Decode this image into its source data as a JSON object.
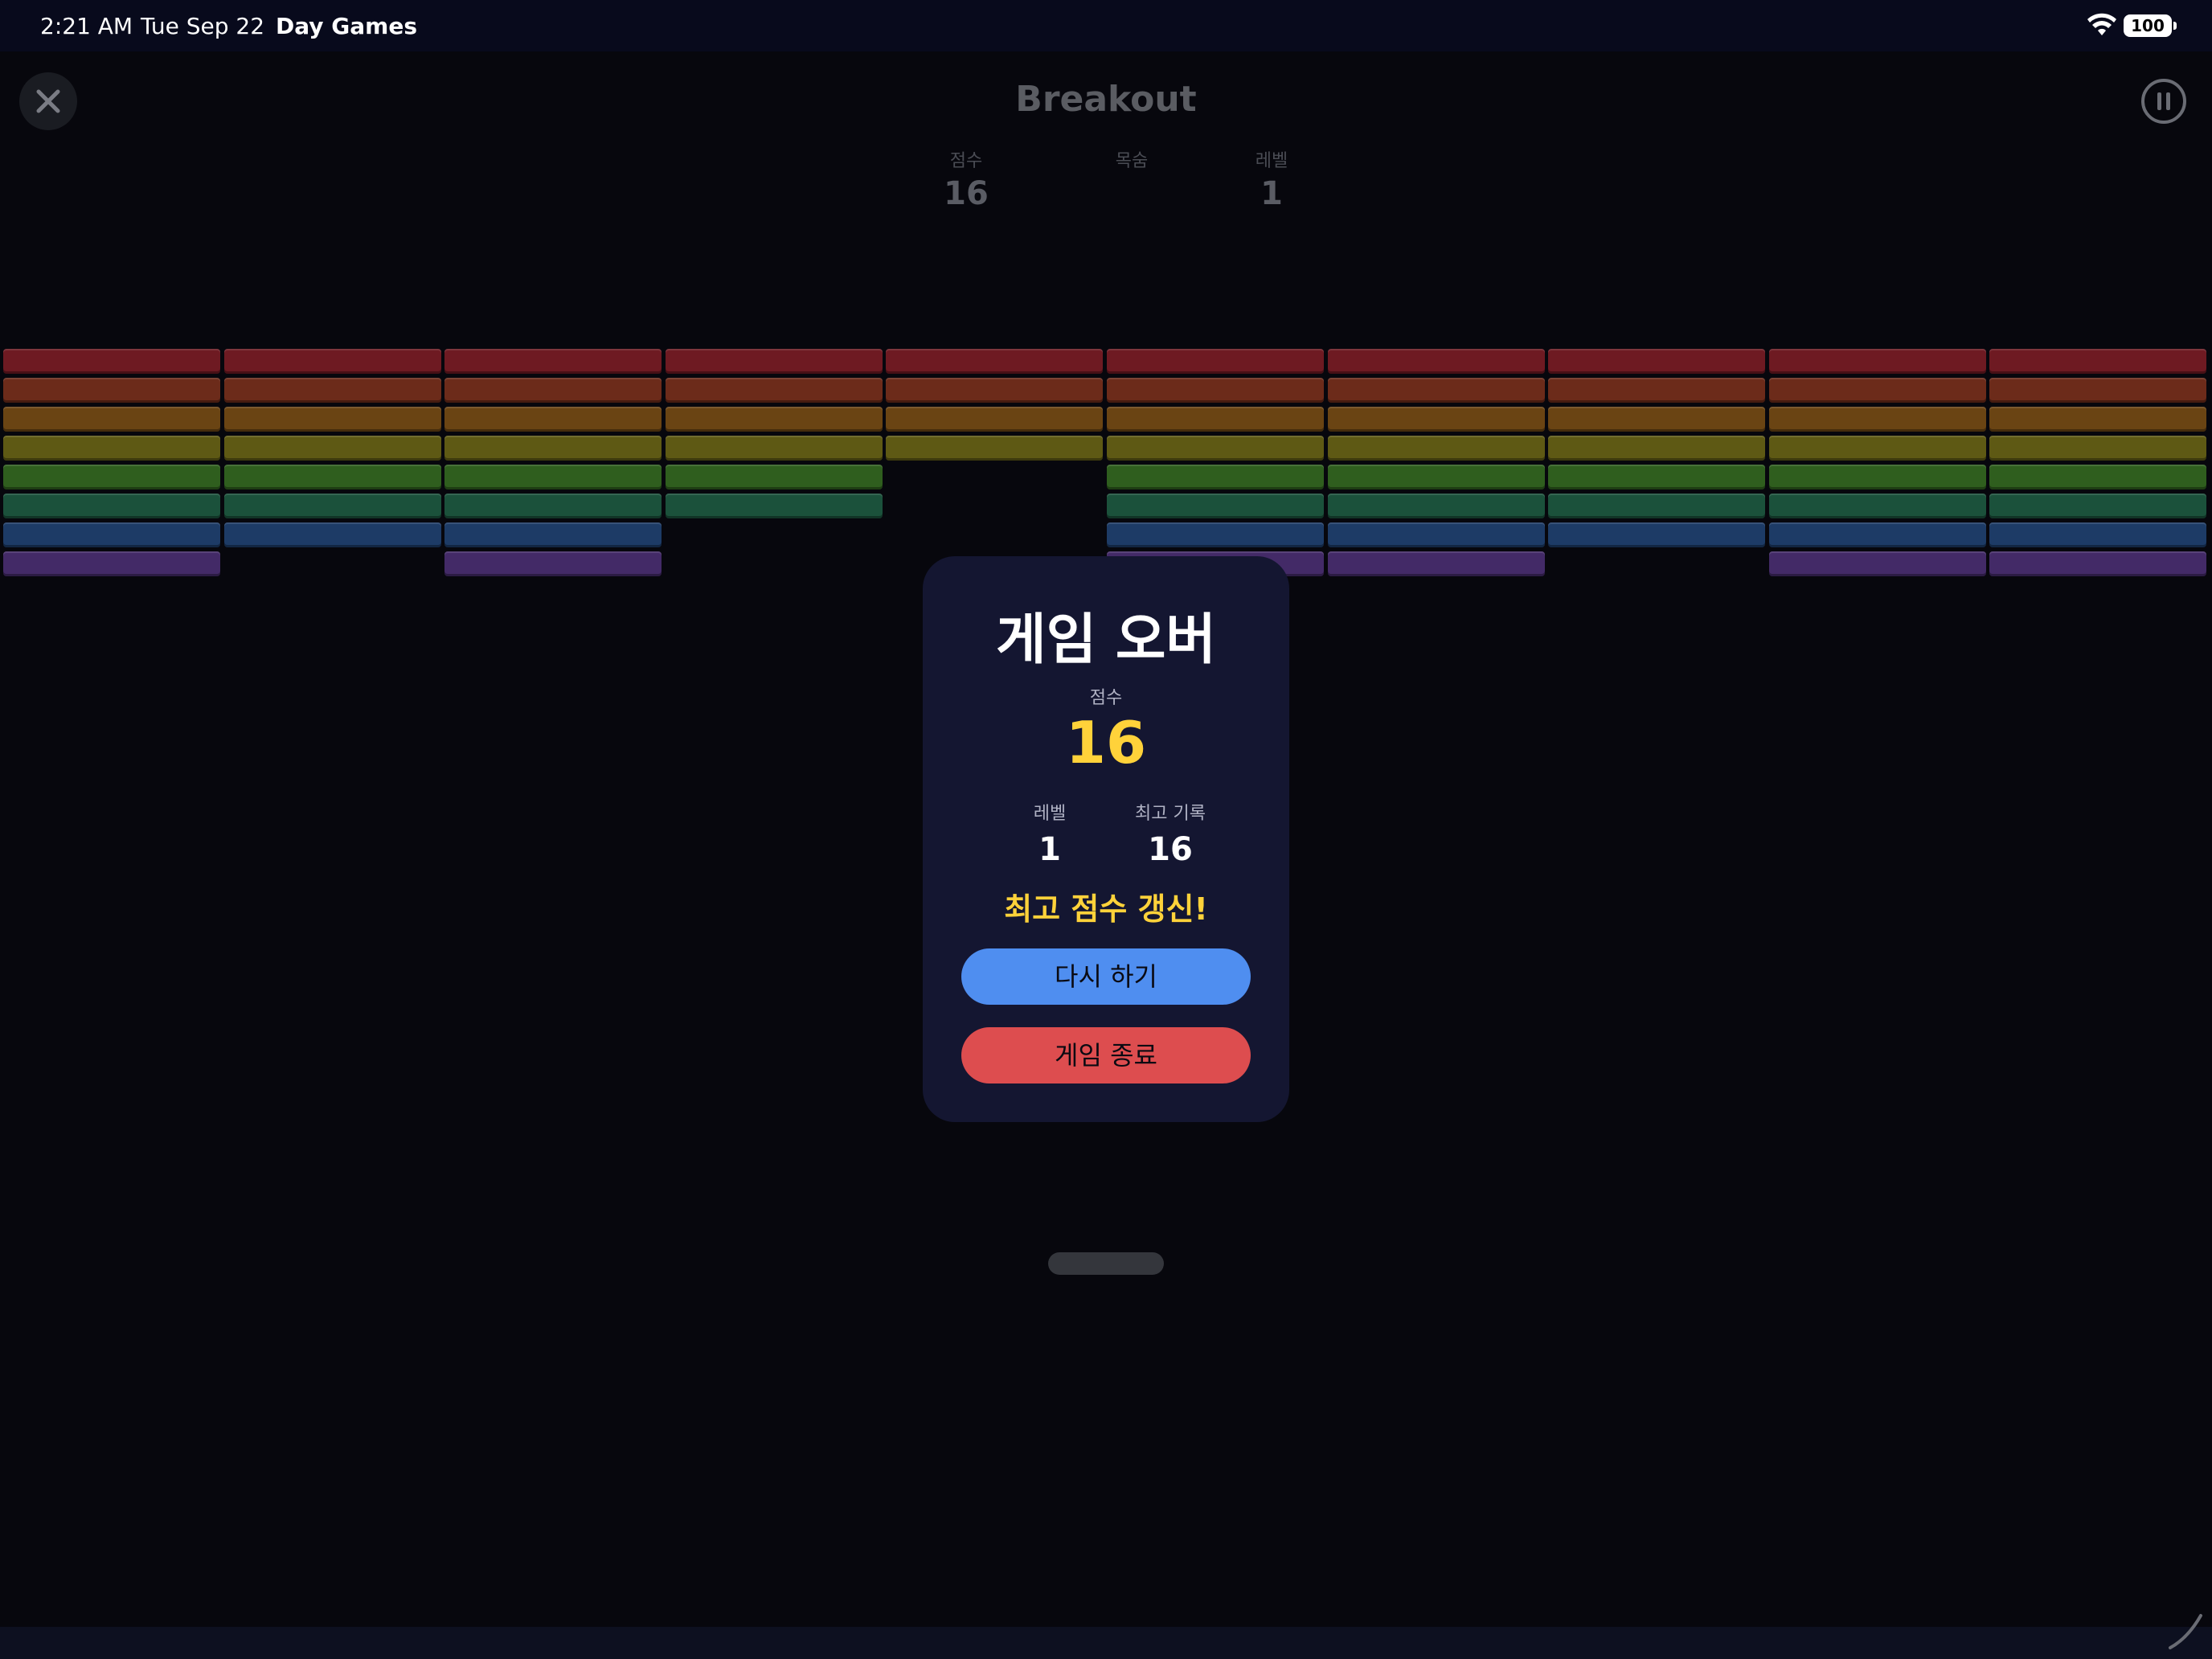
{
  "status_bar": {
    "time": "2:21 AM",
    "date": "Tue Sep 22",
    "app_name": "Day Games",
    "battery": "100",
    "wifi_icon": "wifi-icon"
  },
  "game": {
    "title": "Breakout",
    "hud": {
      "score_label": "점수",
      "score": "16",
      "lives_label": "목숨",
      "level_label": "레벨",
      "level": "1"
    },
    "brick_colors": [
      "#6e1a22",
      "#6c2b1a",
      "#6a4413",
      "#5e5914",
      "#2f5e1e",
      "#1b513b",
      "#1d3b66",
      "#432a67"
    ],
    "brick_rows": [
      [
        1,
        1,
        1,
        1,
        1,
        1,
        1,
        1,
        1,
        1
      ],
      [
        1,
        1,
        1,
        1,
        1,
        1,
        1,
        1,
        1,
        1
      ],
      [
        1,
        1,
        1,
        1,
        1,
        1,
        1,
        1,
        1,
        1
      ],
      [
        1,
        1,
        1,
        1,
        1,
        1,
        1,
        1,
        1,
        1
      ],
      [
        1,
        1,
        1,
        1,
        0,
        1,
        1,
        1,
        1,
        1
      ],
      [
        1,
        1,
        1,
        1,
        0,
        1,
        1,
        1,
        1,
        1
      ],
      [
        1,
        1,
        1,
        0,
        0,
        1,
        1,
        1,
        1,
        1
      ],
      [
        1,
        0,
        1,
        0,
        0,
        1,
        1,
        0,
        1,
        1
      ]
    ]
  },
  "modal": {
    "title": "게임 오버",
    "score_label": "점수",
    "score": "16",
    "level_label": "레벨",
    "level": "1",
    "best_label": "최고 기록",
    "best": "16",
    "new_record": "최고 점수 갱신!",
    "retry_label": "다시 하기",
    "quit_label": "게임 종료",
    "colors": {
      "accent": "#ffd23a",
      "retry": "#4f8ef0",
      "quit": "#dd4d4f",
      "panel": "#141631"
    }
  }
}
